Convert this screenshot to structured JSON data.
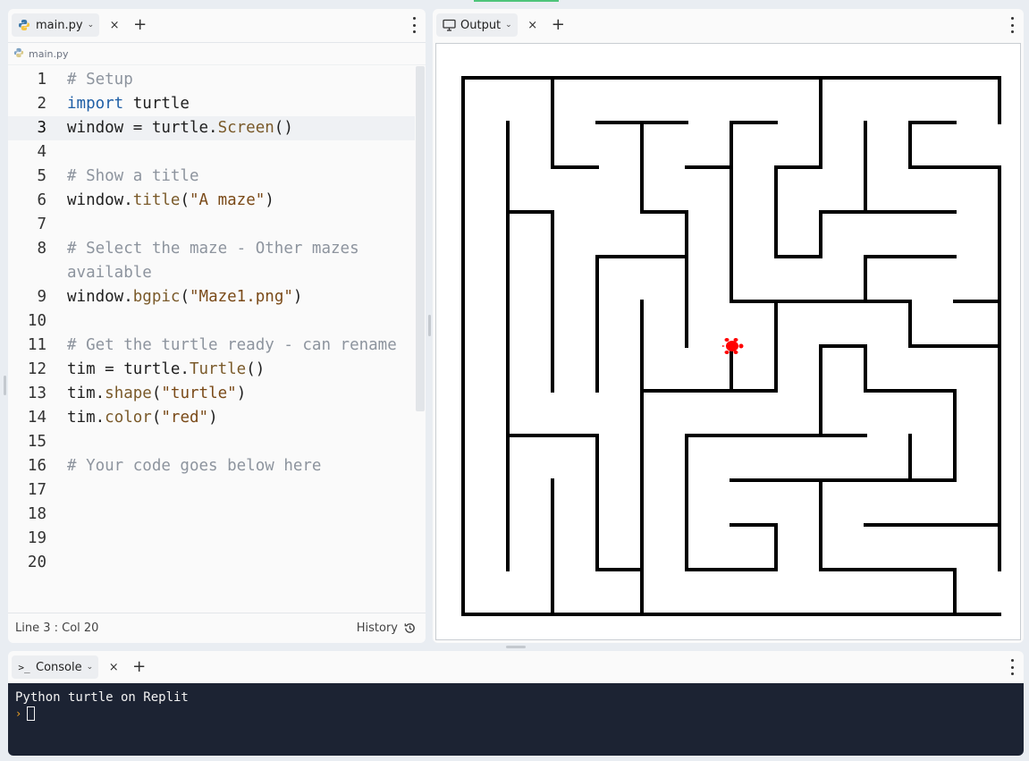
{
  "editor": {
    "tab": {
      "label": "main.py",
      "icon": "python-icon"
    },
    "breadcrumb": "main.py",
    "lines": [
      {
        "n": "1"
      },
      {
        "n": "2"
      },
      {
        "n": "3"
      },
      {
        "n": "4"
      },
      {
        "n": "5"
      },
      {
        "n": "6"
      },
      {
        "n": "7"
      },
      {
        "n": "8"
      },
      {
        "n": "9"
      },
      {
        "n": "10"
      },
      {
        "n": "11"
      },
      {
        "n": "12"
      },
      {
        "n": "13"
      },
      {
        "n": "14"
      },
      {
        "n": "15"
      },
      {
        "n": "16"
      },
      {
        "n": "17"
      },
      {
        "n": "18"
      },
      {
        "n": "19"
      },
      {
        "n": "20"
      }
    ],
    "code": {
      "l1": "# Setup",
      "l2_kw": "import",
      "l2_rest": " turtle",
      "l3_a": "window = turtle.",
      "l3_fn": "Screen",
      "l3_b": "()",
      "l5": "# Show a title",
      "l6_a": "window.",
      "l6_fn": "title",
      "l6_b": "(",
      "l6_str": "\"A maze\"",
      "l6_c": ")",
      "l8a": "# Select the maze - Other mazes",
      "l8b": "available",
      "l9_a": "window.",
      "l9_fn": "bgpic",
      "l9_b": "(",
      "l9_str": "\"Maze1.png\"",
      "l9_c": ")",
      "l11": "# Get the turtle ready - can rename",
      "l12_a": "tim = turtle.",
      "l12_fn": "Turtle",
      "l12_b": "()",
      "l13_a": "tim.",
      "l13_fn": "shape",
      "l13_b": "(",
      "l13_str": "\"turtle\"",
      "l13_c": ")",
      "l14_a": "tim.",
      "l14_fn": "color",
      "l14_b": "(",
      "l14_str": "\"red\"",
      "l14_c": ")",
      "l16": "# Your code goes below here"
    },
    "status": {
      "position": "Line 3 : Col 20",
      "history_label": "History"
    }
  },
  "output": {
    "tab": {
      "label": "Output",
      "icon": "monitor-icon"
    },
    "turtle_color": "#ff0000"
  },
  "console": {
    "tab": {
      "label": "Console",
      "icon": "terminal-icon"
    },
    "output_text": "Python turtle on Replit",
    "prompt_symbol": "›"
  },
  "colors": {
    "console_bg": "#1c2333",
    "prompt_accent": "#f5a623",
    "keyword": "#1f5fa6",
    "comment": "#8d949e"
  }
}
